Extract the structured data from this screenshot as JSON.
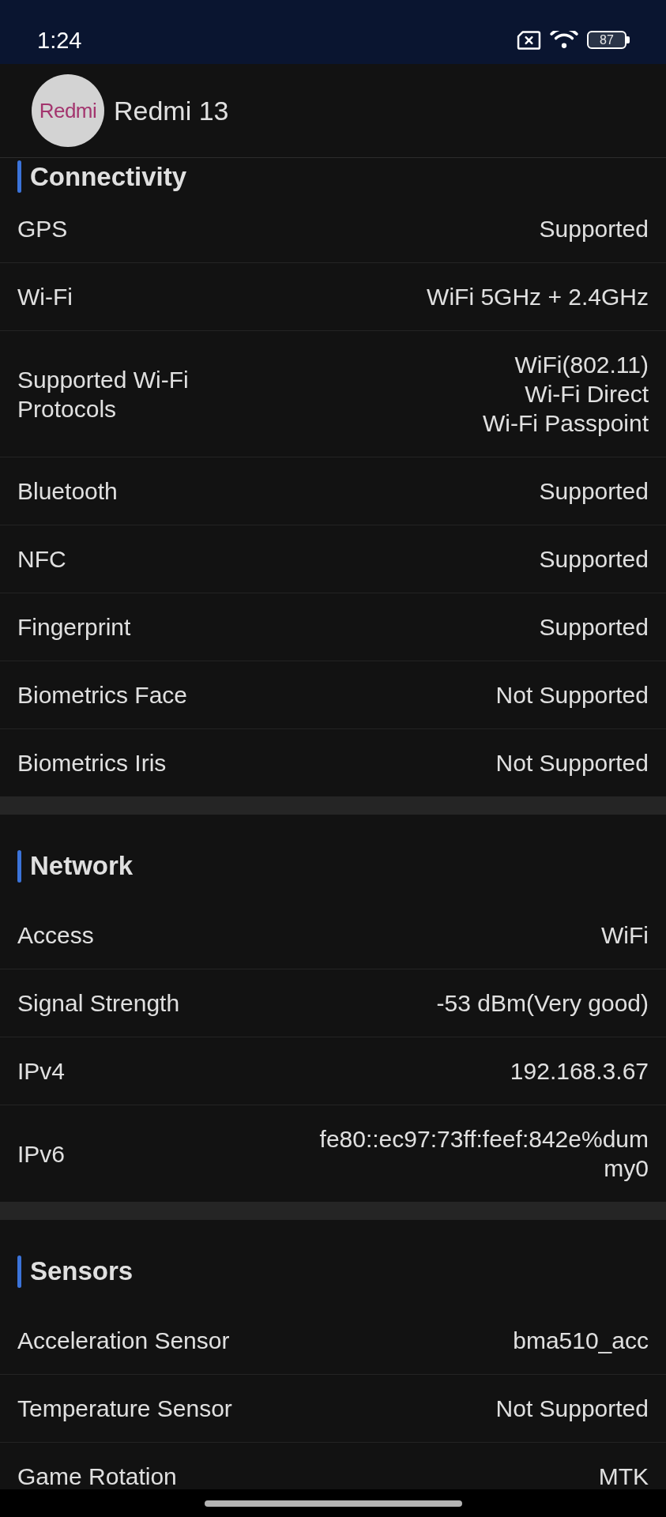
{
  "status_bar": {
    "time": "1:24",
    "battery": "87"
  },
  "header": {
    "logo": "Redmi",
    "title": "Redmi 13"
  },
  "sections": [
    {
      "title": "Connectivity",
      "rows": [
        {
          "label": "GPS",
          "value": "Supported"
        },
        {
          "label": "Wi-Fi",
          "value": "WiFi 5GHz + 2.4GHz"
        },
        {
          "label": "Supported Wi-Fi Protocols",
          "value": "WiFi(802.11)\nWi-Fi Direct\nWi-Fi Passpoint"
        },
        {
          "label": "Bluetooth",
          "value": "Supported"
        },
        {
          "label": "NFC",
          "value": "Supported"
        },
        {
          "label": "Fingerprint",
          "value": "Supported"
        },
        {
          "label": "Biometrics Face",
          "value": "Not Supported"
        },
        {
          "label": "Biometrics Iris",
          "value": "Not Supported"
        }
      ]
    },
    {
      "title": "Network",
      "rows": [
        {
          "label": "Access",
          "value": "WiFi"
        },
        {
          "label": "Signal Strength",
          "value": "-53 dBm(Very good)"
        },
        {
          "label": "IPv4",
          "value": "192.168.3.67"
        },
        {
          "label": "IPv6",
          "value": "fe80::ec97:73ff:feef:842e%dummy0"
        }
      ]
    },
    {
      "title": "Sensors",
      "rows": [
        {
          "label": "Acceleration Sensor",
          "value": "bma510_acc"
        },
        {
          "label": "Temperature Sensor",
          "value": "Not Supported"
        },
        {
          "label": "Game Rotation",
          "value": "MTK"
        }
      ]
    }
  ]
}
